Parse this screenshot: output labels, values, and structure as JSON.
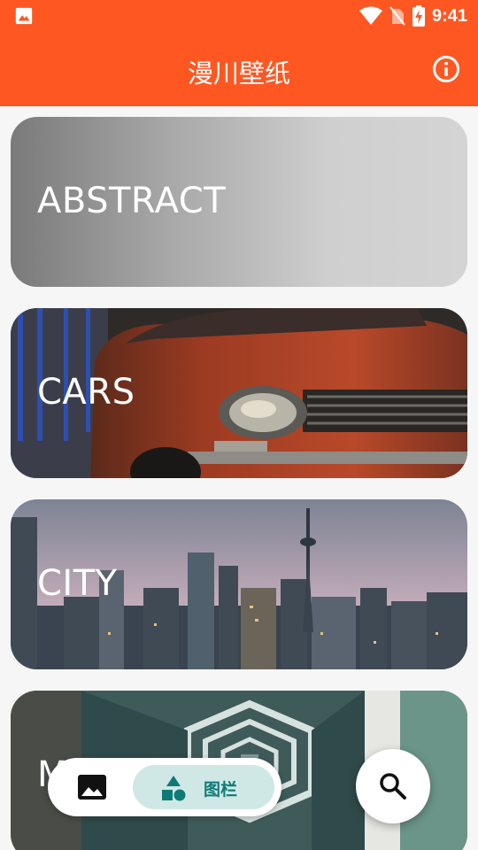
{
  "status_bar": {
    "time": "9:41",
    "icons": [
      "gallery-icon",
      "wifi-icon",
      "no-sim-icon",
      "battery-charging-icon"
    ]
  },
  "app_bar": {
    "title": "漫川壁纸",
    "info_icon": "info-icon"
  },
  "categories": [
    {
      "label": "ABSTRACT"
    },
    {
      "label": "CARS"
    },
    {
      "label": "CITY"
    },
    {
      "label": "M"
    }
  ],
  "bottom_nav": {
    "wallpaper_icon": "image-icon",
    "category_label": "图栏",
    "category_icon": "shapes-icon"
  },
  "fab": {
    "icon": "search-icon"
  },
  "colors": {
    "primary": "#ff5722",
    "nav_selected_bg": "#cfe8e6",
    "nav_selected_fg": "#0e7a76"
  }
}
